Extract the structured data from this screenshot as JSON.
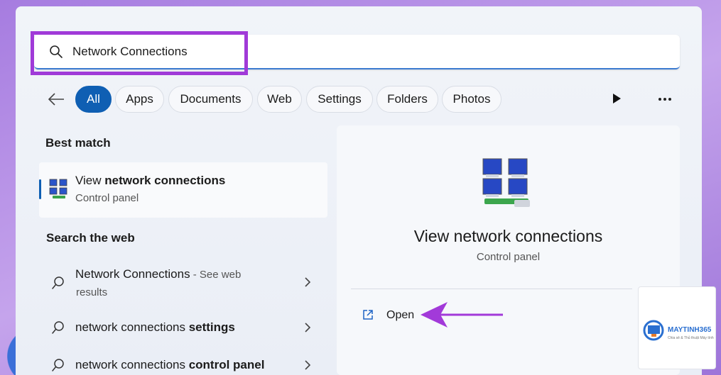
{
  "search": {
    "value": "Network Connections"
  },
  "filters": {
    "items": [
      {
        "label": "All",
        "active": true
      },
      {
        "label": "Apps"
      },
      {
        "label": "Documents"
      },
      {
        "label": "Web"
      },
      {
        "label": "Settings"
      },
      {
        "label": "Folders"
      },
      {
        "label": "Photos"
      }
    ]
  },
  "left": {
    "best_match_title": "Best match",
    "best_match": {
      "title_plain": "View ",
      "title_bold": "network connections",
      "subtitle": "Control panel"
    },
    "web_title": "Search the web",
    "web_results": [
      {
        "text": "Network Connections",
        "suffix": " - See web",
        "sub": "results"
      },
      {
        "text": "network connections ",
        "bold": "settings"
      },
      {
        "text": "network connections ",
        "bold": "control panel"
      }
    ]
  },
  "preview": {
    "title": "View network connections",
    "subtitle": "Control panel",
    "open_label": "Open"
  },
  "watermark": {
    "brand": "MAYTINH365",
    "tagline": "Chia sẻ & Thủ thuật Máy tính"
  },
  "colors": {
    "accent": "#0f5fb3",
    "highlight": "#a03ad8"
  }
}
